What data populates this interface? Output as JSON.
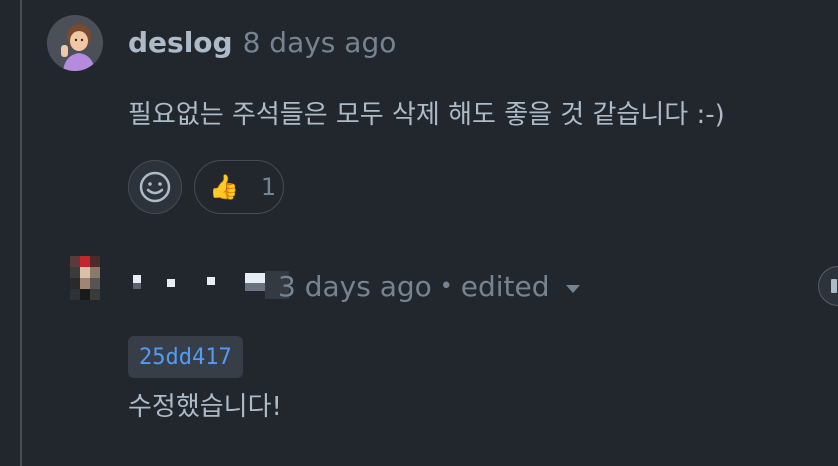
{
  "comment1": {
    "author": "deslog",
    "timestamp": "8 days ago",
    "body": "필요없는 주석들은 모두 삭제 해도 좋을 것 같습니다 :-)",
    "reactions": [
      {
        "icon": "thumbs-up-icon",
        "emoji": "👍",
        "count": "1"
      }
    ],
    "add_reaction_icon": "smiley-icon"
  },
  "comment2": {
    "author_redacted": true,
    "timestamp_fragment": "3 days ago",
    "edited_label": "edited",
    "commit_sha": "25dd417",
    "body": "수정했습니다!"
  },
  "colors": {
    "background": "#22272e",
    "text_primary": "#adbac7",
    "text_muted": "#768390",
    "border": "#444c56",
    "link": "#539bf5"
  }
}
